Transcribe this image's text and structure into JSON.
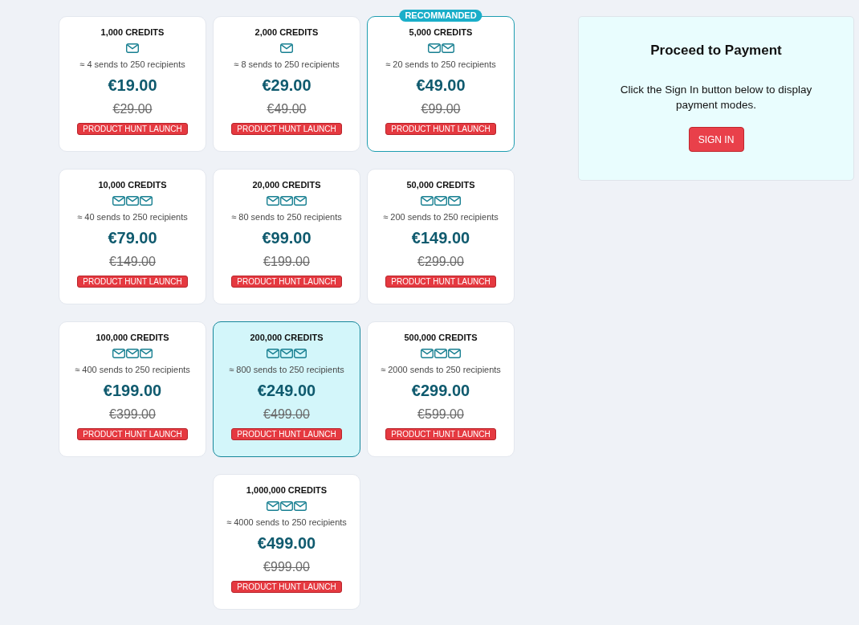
{
  "plans": [
    {
      "credits": "1,000 CREDITS",
      "kind": "single",
      "sends": "≈ 4 sends to 250 recipients",
      "price": "€19.00",
      "old_price": "€29.00",
      "tag": "PRODUCT HUNT LAUNCH",
      "selected": false
    },
    {
      "credits": "2,000 CREDITS",
      "kind": "single",
      "sends": "≈ 8 sends to 250 recipients",
      "price": "€29.00",
      "old_price": "€49.00",
      "tag": "PRODUCT HUNT LAUNCH",
      "selected": false
    },
    {
      "badge": "RECOMMANDED",
      "credits": "5,000 CREDITS",
      "kind": "double",
      "sends": "≈ 20 sends to 250 recipients",
      "price": "€49.00",
      "old_price": "€99.00",
      "tag": "PRODUCT HUNT LAUNCH",
      "selected": false
    },
    {
      "credits": "10,000 CREDITS",
      "kind": "triple",
      "sends": "≈ 40 sends to 250 recipients",
      "price": "€79.00",
      "old_price": "€149.00",
      "tag": "PRODUCT HUNT LAUNCH",
      "selected": false
    },
    {
      "credits": "20,000 CREDITS",
      "kind": "triple",
      "sends": "≈ 80 sends to 250 recipients",
      "price": "€99.00",
      "old_price": "€199.00",
      "tag": "PRODUCT HUNT LAUNCH",
      "selected": false
    },
    {
      "credits": "50,000 CREDITS",
      "kind": "triple",
      "sends": "≈ 200 sends to 250 recipients",
      "price": "€149.00",
      "old_price": "€299.00",
      "tag": "PRODUCT HUNT LAUNCH",
      "selected": false
    },
    {
      "credits": "100,000 CREDITS",
      "kind": "triple",
      "sends": "≈ 400 sends to 250 recipients",
      "price": "€199.00",
      "old_price": "€399.00",
      "tag": "PRODUCT HUNT LAUNCH",
      "selected": false
    },
    {
      "credits": "200,000 CREDITS",
      "kind": "triple",
      "sends": "≈ 800 sends to 250 recipients",
      "price": "€249.00",
      "old_price": "€499.00",
      "tag": "PRODUCT HUNT LAUNCH",
      "selected": true
    },
    {
      "credits": "500,000 CREDITS",
      "kind": "triple",
      "sends": "≈ 2000 sends to 250 recipients",
      "price": "€299.00",
      "old_price": "€599.00",
      "tag": "PRODUCT HUNT LAUNCH",
      "selected": false
    },
    {
      "credits": "1,000,000 CREDITS",
      "kind": "triple",
      "sends": "≈ 4000 sends to 250 recipients",
      "price": "€499.00",
      "old_price": "€999.00",
      "tag": "PRODUCT HUNT LAUNCH",
      "selected": false
    }
  ],
  "payment": {
    "title": "Proceed to Payment",
    "message": "Click the Sign In button below to display payment modes.",
    "button": "SIGN IN"
  }
}
